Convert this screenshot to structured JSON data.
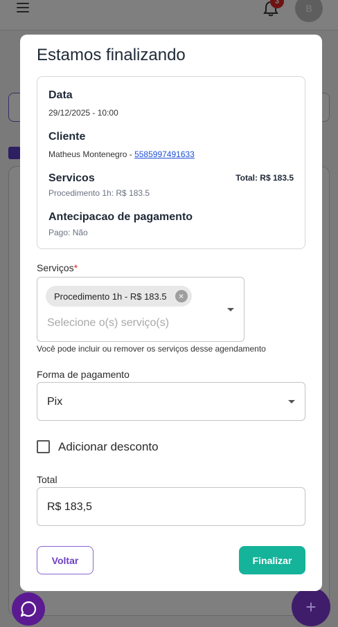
{
  "background": {
    "notification_count": "3",
    "avatar_initial": "B"
  },
  "modal": {
    "title": "Estamos finalizando",
    "summary": {
      "date_label": "Data",
      "date_value": "29/12/2025 - 10:00",
      "client_label": "Cliente",
      "client_name": "Matheus Montenegro - ",
      "client_phone": "5585997491633",
      "services_label": "Servicos",
      "services_detail": "Procedimento 1h: R$ 183.5",
      "services_total": "Total: R$ 183.5",
      "prepayment_label": "Antecipacao de pagamento",
      "prepayment_value": "Pago: Não"
    },
    "services_field": {
      "label": "Serviços",
      "required_mark": "*",
      "chips": [
        "Procedimento 1h - R$ 183.5"
      ],
      "placeholder": "Selecione o(s) serviço(s)",
      "helper": "Você pode incluir ou remover os serviços desse agendamento"
    },
    "payment_field": {
      "label": "Forma de pagamento",
      "value": "Pix"
    },
    "discount": {
      "label": "Adicionar desconto",
      "checked": false
    },
    "total_field": {
      "label": "Total",
      "value": "R$ 183,5"
    },
    "buttons": {
      "back": "Voltar",
      "finish": "Finalizar"
    }
  },
  "colors": {
    "primary": "#6d3fc0",
    "finish": "#14b39a",
    "required": "#dc2626",
    "link": "#1d4ed8"
  }
}
